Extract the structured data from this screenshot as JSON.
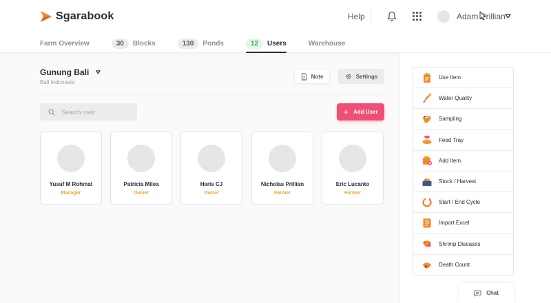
{
  "header": {
    "logo_text": "Sgarabook",
    "help_label": "Help",
    "user_name": "Adam Prillian"
  },
  "tabs": [
    {
      "label": "Farm Overview",
      "count": null
    },
    {
      "label": "Blocks",
      "count": "30"
    },
    {
      "label": "Ponds",
      "count": "130"
    },
    {
      "label": "Users",
      "count": "12",
      "active": true
    },
    {
      "label": "Warehouse",
      "count": null
    }
  ],
  "farm": {
    "name": "Gunung Bali",
    "location": "Bali Indonesia"
  },
  "toolbar": {
    "note_label": "Note",
    "settings_label": "Settings",
    "add_user_label": "Add User"
  },
  "search": {
    "placeholder": "Search user",
    "value": ""
  },
  "users": [
    {
      "name": "Yusuf M Rohmat",
      "role": "Manager"
    },
    {
      "name": "Patricia Milea",
      "role": "Owner"
    },
    {
      "name": "Haris CJ",
      "role": "Owner"
    },
    {
      "name": "Nicholas Prillian",
      "role": "Farmer"
    },
    {
      "name": "Eric Lucanto",
      "role": "Farmer"
    }
  ],
  "actions": [
    {
      "label": "Use Item",
      "icon": "use-item-icon"
    },
    {
      "label": "Water Quality",
      "icon": "water-quality-icon"
    },
    {
      "label": "Sampling",
      "icon": "sampling-icon"
    },
    {
      "label": "Feed Tray",
      "icon": "feed-tray-icon"
    },
    {
      "label": "Add Item",
      "icon": "add-item-icon"
    },
    {
      "label": "Stock / Harvest",
      "icon": "stock-harvest-icon"
    },
    {
      "label": "Start / End Cycle",
      "icon": "cycle-icon"
    },
    {
      "label": "Import Excel",
      "icon": "import-excel-icon"
    },
    {
      "label": "Shrimp Diseases",
      "icon": "shrimp-diseases-icon"
    },
    {
      "label": "Death Count",
      "icon": "death-count-icon"
    }
  ],
  "chat_label": "Chat",
  "colors": {
    "accent": "#ef4f74",
    "brand_orange": "#f5892a",
    "role_yellow": "#f2a62b",
    "active_badge_green": "#29a85b"
  }
}
